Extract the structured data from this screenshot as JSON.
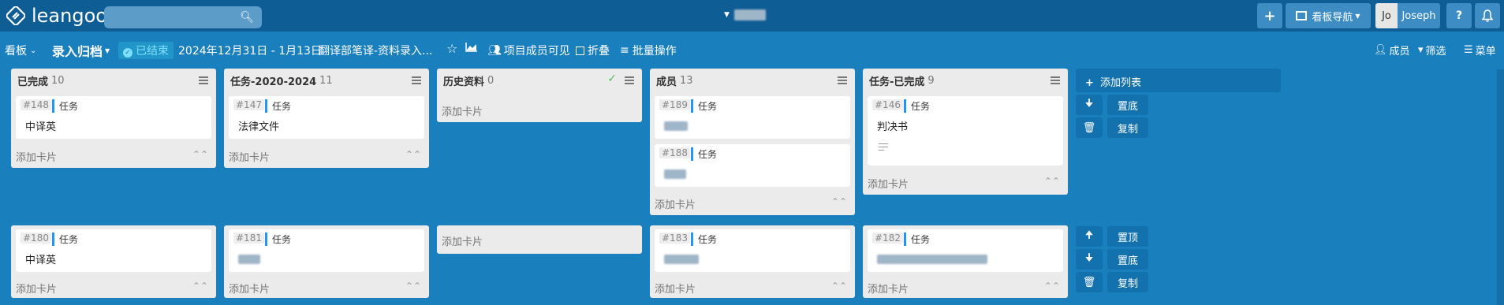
{
  "app": {
    "logo_text": "leangoo",
    "search_placeholder": "",
    "board_switcher_label": "",
    "add_label": "+",
    "board_nav_label": "看板导航",
    "user_initials": "Jo",
    "user_name": "Joseph",
    "help_label": "?"
  },
  "board_header": {
    "view_label": "看板",
    "board_name": "录入归档",
    "status": "已结束",
    "date_range": "2024年12月31日 - 1月13日",
    "description": "翻译部笔译-资料录入...",
    "visibility": "项目成员可见",
    "fold_label": "折叠",
    "batch_label": "批量操作",
    "members_label": "成员",
    "filter_label": "筛选",
    "menu_label": "菜单"
  },
  "add_card_label": "添加卡片",
  "add_list_label": "添加列表",
  "lists": [
    {
      "name": "已完成",
      "count": "10"
    },
    {
      "name": "任务-2020-2024",
      "count": "11"
    },
    {
      "name": "历史资料",
      "count": "0"
    },
    {
      "name": "成员",
      "count": "13"
    },
    {
      "name": "任务-已完成",
      "count": "9"
    }
  ],
  "cards": [
    {
      "num": "#148",
      "tag": "任务",
      "title": "中译英"
    },
    {
      "num": "#147",
      "tag": "任务",
      "title": "法律文件"
    },
    {
      "num": "#189",
      "tag": "任务",
      "title": ""
    },
    {
      "num": "#188",
      "tag": "任务",
      "title": ""
    },
    {
      "num": "#146",
      "tag": "任务",
      "title": "判决书"
    },
    {
      "num": "#180",
      "tag": "任务",
      "title": "中译英"
    },
    {
      "num": "#181",
      "tag": "任务",
      "title": ""
    },
    {
      "num": "#183",
      "tag": "任务",
      "title": ""
    },
    {
      "num": "#182",
      "tag": "任务",
      "title": ""
    }
  ],
  "lane_actions": {
    "lane1": [
      "置底",
      "复制"
    ],
    "lane2": [
      "置顶",
      "置底",
      "复制"
    ]
  },
  "colors": {
    "background": "#1a7fbd",
    "topbar": "#0f5d95",
    "tag": "#2196f3"
  }
}
